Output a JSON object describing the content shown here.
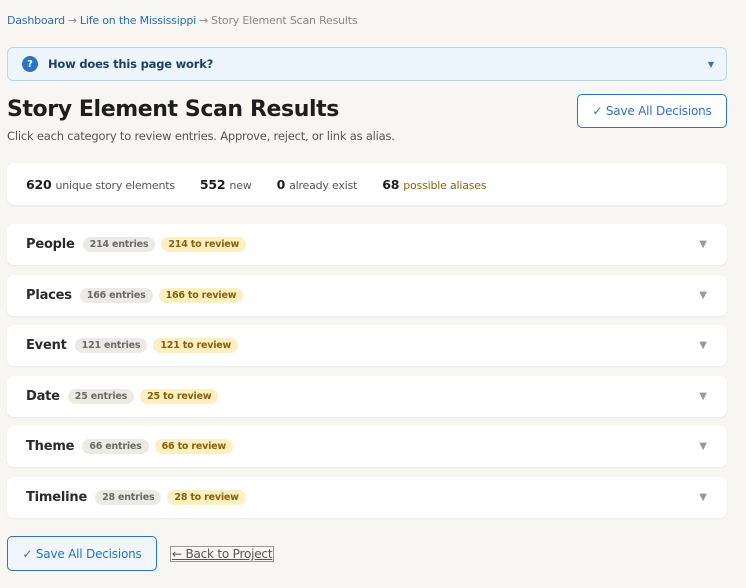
{
  "breadcrumb": {
    "items": [
      "Dashboard",
      "Life on the Mississippi",
      "Story Element Scan Results"
    ],
    "separator": "→"
  },
  "help": {
    "icon_text": "?",
    "label": "How does this page work?",
    "chevron": "▼"
  },
  "header": {
    "title": "Story Element Scan Results",
    "subtitle": "Click each category to review entries. Approve, reject, or link as alias.",
    "save_label": "✓ Save All Decisions"
  },
  "stats": {
    "unique_value": "620",
    "unique_label": "unique story elements",
    "new_value": "552",
    "new_label": "new",
    "exist_value": "0",
    "exist_label": "already exist",
    "alias_value": "68",
    "alias_label": "possible aliases"
  },
  "categories": [
    {
      "name": "People",
      "entries": "214 entries",
      "review": "214 to review"
    },
    {
      "name": "Places",
      "entries": "166 entries",
      "review": "166 to review"
    },
    {
      "name": "Event",
      "entries": "121 entries",
      "review": "121 to review"
    },
    {
      "name": "Date",
      "entries": "25 entries",
      "review": "25 to review"
    },
    {
      "name": "Theme",
      "entries": "66 entries",
      "review": "66 to review"
    },
    {
      "name": "Timeline",
      "entries": "28 entries",
      "review": "28 to review"
    }
  ],
  "category_chevron": "▼",
  "footer": {
    "save_label": "✓ Save All Decisions",
    "back_label": "← Back to Project"
  }
}
